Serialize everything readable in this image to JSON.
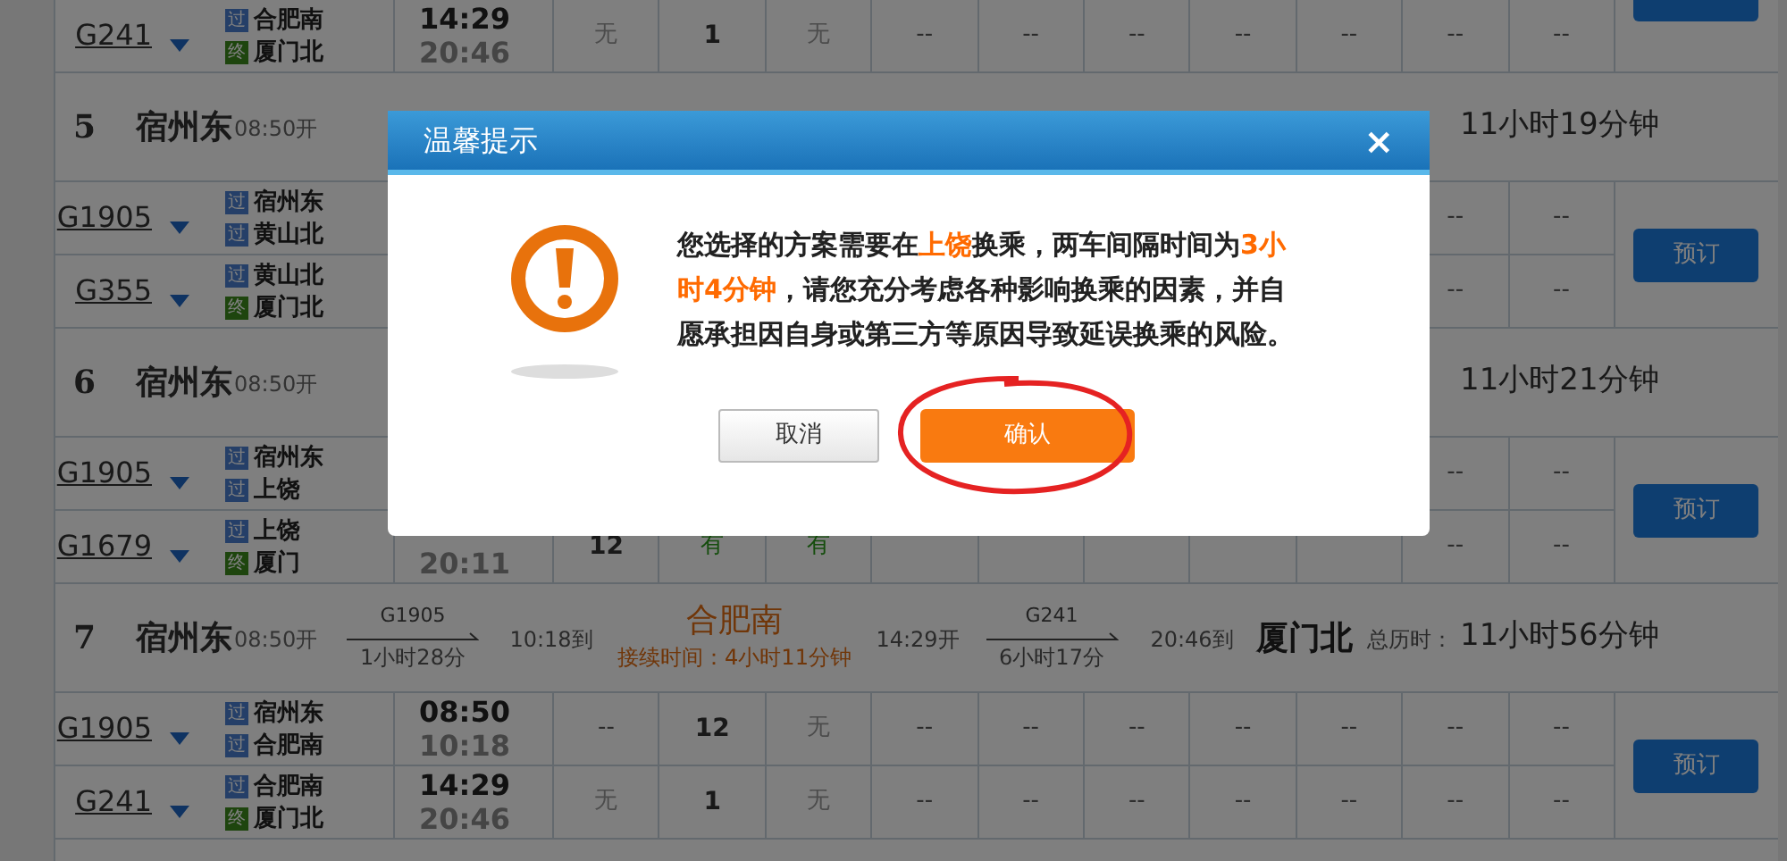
{
  "groups": [
    {
      "trains": [
        {
          "number": "G241",
          "stations": [
            {
              "kind": "pass",
              "badge": "过",
              "name": "合肥南"
            },
            {
              "kind": "end",
              "badge": "终",
              "name": "厦门北"
            }
          ],
          "depart": "14:29",
          "arrive": "20:46",
          "seats_start": [
            {
              "kind": "none",
              "text": "无"
            },
            {
              "kind": "count",
              "text": "1"
            },
            {
              "kind": "none",
              "text": "无"
            },
            {
              "kind": "dash",
              "text": "--"
            },
            {
              "kind": "dash",
              "text": "--"
            },
            {
              "kind": "dash",
              "text": "--"
            },
            {
              "kind": "dash",
              "text": "--"
            },
            {
              "kind": "dash",
              "text": "--"
            },
            {
              "kind": "dash",
              "text": "--"
            },
            {
              "kind": "dash",
              "text": "--"
            }
          ]
        }
      ]
    },
    {
      "header": {
        "number": "5",
        "station": "宿州东",
        "depart": "08:50开",
        "total": "11小时19分钟"
      },
      "trains": [
        {
          "number": "G1905",
          "stations": [
            {
              "kind": "pass",
              "badge": "过",
              "name": "宿州东"
            },
            {
              "kind": "pass",
              "badge": "过",
              "name": "黄山北"
            }
          ],
          "seats_end": [
            {
              "kind": "dash",
              "text": "--"
            },
            {
              "kind": "dash",
              "text": "--"
            }
          ]
        },
        {
          "number": "G355",
          "stations": [
            {
              "kind": "pass",
              "badge": "过",
              "name": "黄山北"
            },
            {
              "kind": "end",
              "badge": "终",
              "name": "厦门北"
            }
          ],
          "seats_end": [
            {
              "kind": "dash",
              "text": "--"
            },
            {
              "kind": "dash",
              "text": "--"
            }
          ]
        }
      ],
      "book_button": "预订"
    },
    {
      "header": {
        "number": "6",
        "station": "宿州东",
        "depart": "08:50开",
        "total": "11小时21分钟"
      },
      "trains": [
        {
          "number": "G1905",
          "stations": [
            {
              "kind": "pass",
              "badge": "过",
              "name": "宿州东"
            },
            {
              "kind": "pass",
              "badge": "过",
              "name": "上饶"
            }
          ],
          "seats_end": [
            {
              "kind": "dash",
              "text": "--"
            },
            {
              "kind": "dash",
              "text": "--"
            }
          ]
        },
        {
          "number": "G1679",
          "stations": [
            {
              "kind": "pass",
              "badge": "过",
              "name": "上饶"
            },
            {
              "kind": "end",
              "badge": "终",
              "name": "厦门"
            }
          ],
          "arrive": "20:11",
          "seats_start": [
            {
              "kind": "count",
              "text": "12"
            },
            {
              "kind": "available",
              "text": "有"
            },
            {
              "kind": "available",
              "text": "有"
            }
          ],
          "seats_end": [
            {
              "kind": "dash",
              "text": "--"
            },
            {
              "kind": "dash",
              "text": "--"
            }
          ]
        }
      ],
      "book_button": "预订"
    },
    {
      "header": {
        "number": "7",
        "station": "宿州东",
        "depart": "08:50开",
        "leg1_train": "G1905",
        "leg1_duration": "1小时28分",
        "arrive": "10:18到",
        "transfer": "合肥南",
        "wait": "接续时间：4小时11分钟",
        "depart2": "14:29开",
        "leg2_train": "G241",
        "leg2_duration": "6小时17分",
        "arrive2": "20:46到",
        "destination": "厦门北",
        "total_label": "总历时：",
        "total": "11小时56分钟"
      },
      "trains": [
        {
          "number": "G1905",
          "stations": [
            {
              "kind": "pass",
              "badge": "过",
              "name": "宿州东"
            },
            {
              "kind": "pass",
              "badge": "过",
              "name": "合肥南"
            }
          ],
          "depart": "08:50",
          "arrive": "10:18",
          "seats_start": [
            {
              "kind": "dash",
              "text": "--"
            },
            {
              "kind": "count",
              "text": "12"
            },
            {
              "kind": "none",
              "text": "无"
            },
            {
              "kind": "dash",
              "text": "--"
            },
            {
              "kind": "dash",
              "text": "--"
            },
            {
              "kind": "dash",
              "text": "--"
            },
            {
              "kind": "dash",
              "text": "--"
            },
            {
              "kind": "dash",
              "text": "--"
            },
            {
              "kind": "dash",
              "text": "--"
            },
            {
              "kind": "dash",
              "text": "--"
            }
          ]
        },
        {
          "number": "G241",
          "stations": [
            {
              "kind": "pass",
              "badge": "过",
              "name": "合肥南"
            },
            {
              "kind": "end",
              "badge": "终",
              "name": "厦门北"
            }
          ],
          "depart": "14:29",
          "arrive": "20:46",
          "seats_start": [
            {
              "kind": "none",
              "text": "无"
            },
            {
              "kind": "count",
              "text": "1"
            },
            {
              "kind": "none",
              "text": "无"
            },
            {
              "kind": "dash",
              "text": "--"
            },
            {
              "kind": "dash",
              "text": "--"
            },
            {
              "kind": "dash",
              "text": "--"
            },
            {
              "kind": "dash",
              "text": "--"
            },
            {
              "kind": "dash",
              "text": "--"
            },
            {
              "kind": "dash",
              "text": "--"
            },
            {
              "kind": "dash",
              "text": "--"
            }
          ]
        }
      ],
      "book_button": "预订"
    }
  ],
  "dialog": {
    "title": "温馨提示",
    "close": "×",
    "message": "您选择的方案需要在**上饶**换乘，两车间隔时间为**3小时4分钟**，请您充分考虑各种影响换乘的因素，并自愿承担因自身或第三方等原因导致延误换乘的风险。",
    "cancel": "取消",
    "confirm": "确认",
    "confirm_circled": true
  }
}
